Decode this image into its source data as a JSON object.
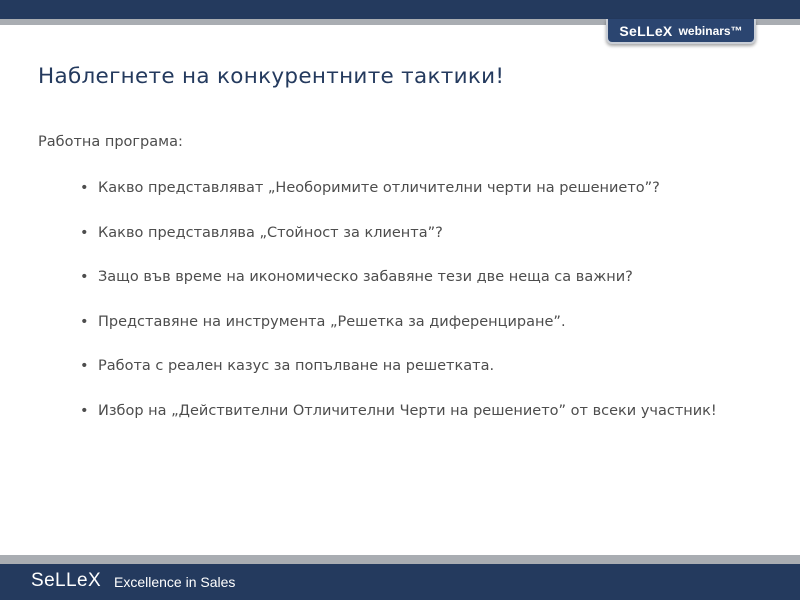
{
  "header": {
    "brand_name": "SeLLeX",
    "brand_sub": "webinars™"
  },
  "slide": {
    "title": "Наблегнете на конкурентните тактики!",
    "intro": "Работна програма:",
    "bullets": [
      "Какво представляват „Необоримите отличителни черти на решението”?",
      "Какво представлява „Стойност за клиента”?",
      "Защо във време на икономическо забавяне тези две неща са важни?",
      "Представяне на инструмента „Решетка за диференциране”.",
      "Работа с реален казус за попълване на решетката.",
      "Избор на „Действителни Отличителни Черти на решението” от всеки участник!"
    ]
  },
  "footer": {
    "brand_name": "SeLLeX",
    "tagline": "Excellence in Sales"
  },
  "colors": {
    "navy": "#243a5e",
    "stripe_gray": "#a9adb2",
    "text_gray": "#4d4d4d"
  }
}
